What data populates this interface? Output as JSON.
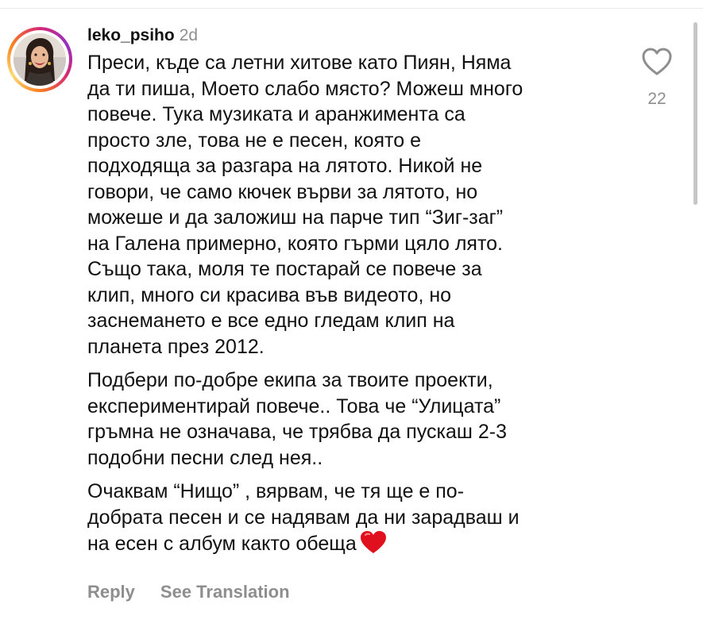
{
  "comment": {
    "username": "leko_psiho",
    "timestamp": "2d",
    "paragraphs": [
      "Преси, къде са летни хитове като Пиян, Няма\nда ти пиша, Моето слабо място? Можеш много\nповече. Тука музиката и аранжимента са\nпросто зле, това не е песен, която е\nподходяща за разгара на лятото. Никой не\nговори, че само кючек върви за лятото, но\nможеше и да заложиш на парче тип “Зиг-заг”\nна Галена примерно, която гърми цяло лято.\nСъщо така, моля те постарай се повече за\nклип, много си красива във видеото, но\nзаснемането е все едно гледам клип на\nпланета през 2012.",
      "Подбери по-добре екипа за твоите проекти,\nекспериментирай повече.. Това че “Улицата”\nгръмна не означава, че трябва да пускаш 2-3\nподобни песни след нея..",
      "Очаквам “Нищо” , вярвам, че тя ще е по-\nдобрата песен и се надявам да ни зарадваш и\nна есен с албум както обеща"
    ],
    "emoji": "heart-emoji"
  },
  "like": {
    "icon": "heart-outline-icon",
    "count": "22"
  },
  "actions": {
    "reply_label": "Reply",
    "translate_label": "See Translation"
  },
  "colors": {
    "text": "#111111",
    "secondary": "#8e8e8e",
    "heart_emoji": "#e0101e",
    "avatar_ring_start": "#d62976",
    "avatar_ring_end": "#feda75"
  }
}
